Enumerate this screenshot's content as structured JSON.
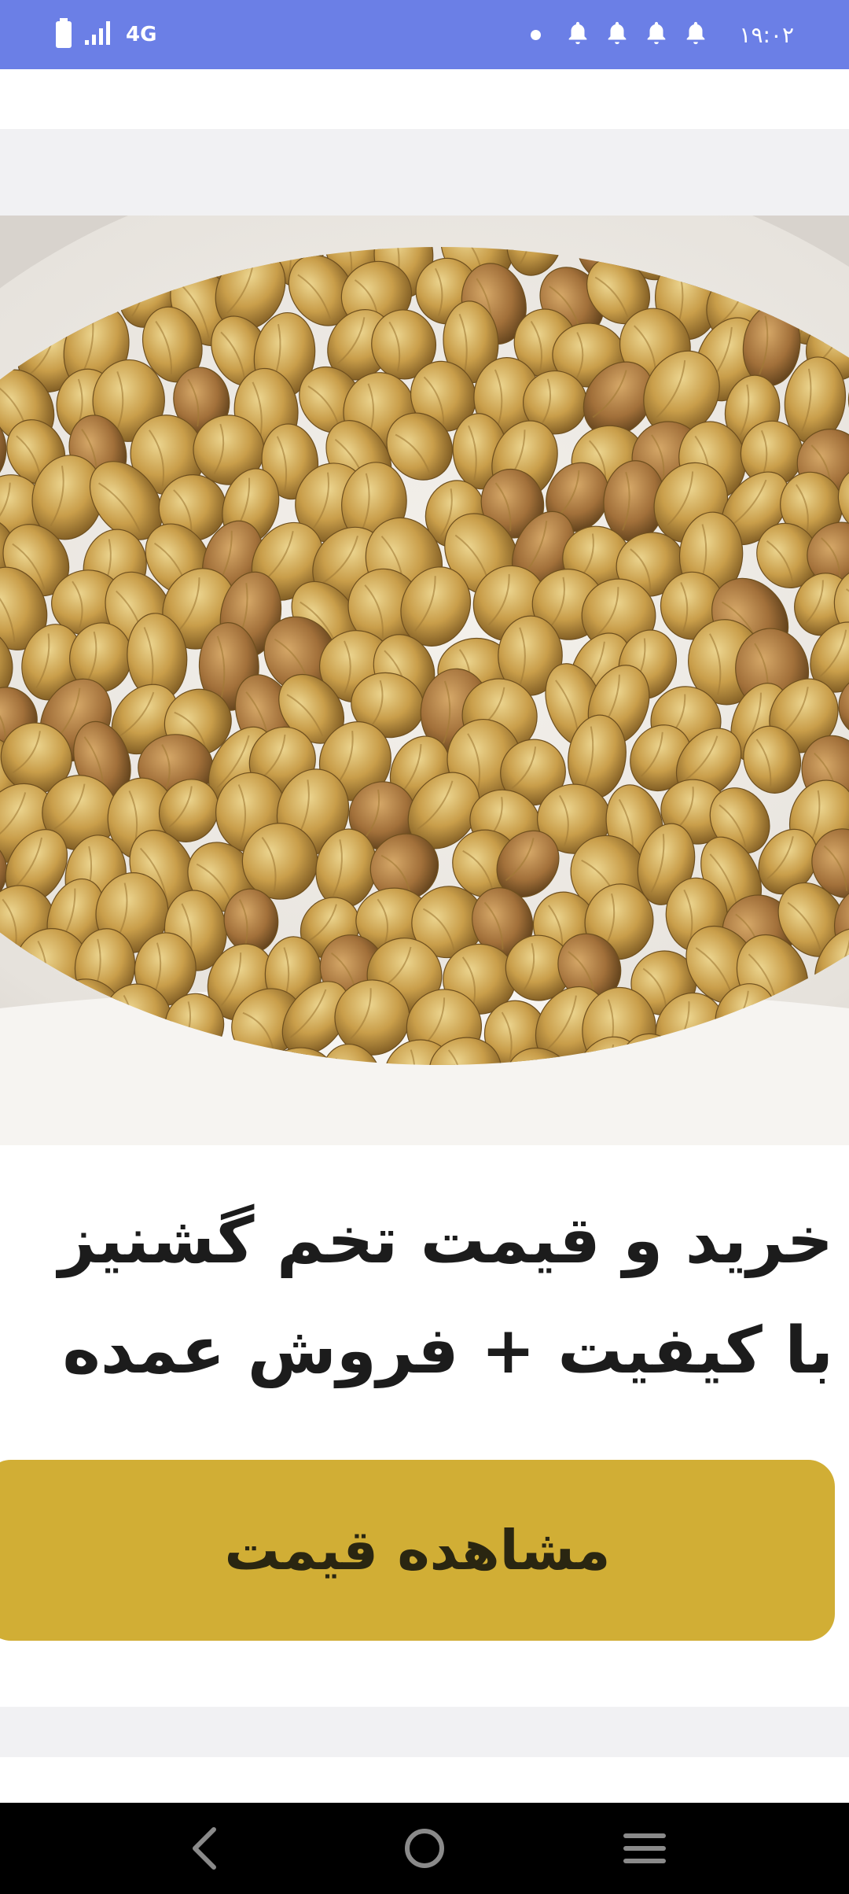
{
  "colors": {
    "status_bar": "#6b7fe6",
    "accent_button": "#d1ae35",
    "title_text": "#1c1c1c",
    "nav_bar": "#000000"
  },
  "status_bar": {
    "network": "4G",
    "time": "۱۹:۰۲",
    "icons": [
      "battery-icon",
      "signal-icon",
      "notification-dot-icon",
      "bell-icon",
      "bell-icon",
      "bell-icon",
      "bell-icon"
    ]
  },
  "product": {
    "title": "خرید و قیمت تخم گشنیز با کیفیت + فروش عمده",
    "button_label": "مشاهده قیمت"
  },
  "nav": {
    "icons": [
      "back-icon",
      "home-icon",
      "menu-icon"
    ]
  }
}
